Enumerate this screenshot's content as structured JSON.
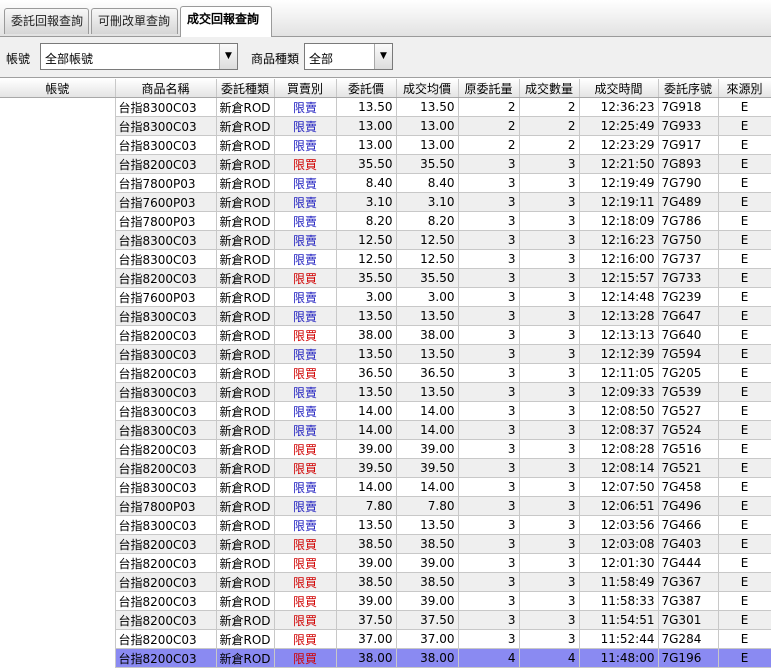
{
  "tabs": [
    {
      "label": "委託回報查詢"
    },
    {
      "label": "可刪改單查詢"
    },
    {
      "label": "成交回報查詢"
    }
  ],
  "filters": {
    "account_label": "帳號",
    "account_value": "全部帳號",
    "product_type_label": "商品種類",
    "product_type_value": "全部"
  },
  "columns": [
    "帳號",
    "商品名稱",
    "委託種類",
    "買賣別",
    "委託價",
    "成交均價",
    "原委託量",
    "成交數量",
    "成交時間",
    "委託序號",
    "來源別"
  ],
  "colors": {
    "buy": "#d00000",
    "sell": "#2020c0",
    "selected_row": "#8a8af2"
  },
  "rows": [
    {
      "product": "台指8300C03",
      "order_type": "新倉ROD",
      "side": "限賣",
      "side_code": "sell",
      "price": "13.50",
      "avg_price": "13.50",
      "order_qty": "2",
      "fill_qty": "2",
      "time": "12:36:23",
      "serial": "7G918",
      "source": "E"
    },
    {
      "product": "台指8300C03",
      "order_type": "新倉ROD",
      "side": "限賣",
      "side_code": "sell",
      "price": "13.00",
      "avg_price": "13.00",
      "order_qty": "2",
      "fill_qty": "2",
      "time": "12:25:49",
      "serial": "7G933",
      "source": "E"
    },
    {
      "product": "台指8300C03",
      "order_type": "新倉ROD",
      "side": "限賣",
      "side_code": "sell",
      "price": "13.00",
      "avg_price": "13.00",
      "order_qty": "2",
      "fill_qty": "2",
      "time": "12:23:29",
      "serial": "7G917",
      "source": "E"
    },
    {
      "product": "台指8200C03",
      "order_type": "新倉ROD",
      "side": "限買",
      "side_code": "buy",
      "price": "35.50",
      "avg_price": "35.50",
      "order_qty": "3",
      "fill_qty": "3",
      "time": "12:21:50",
      "serial": "7G893",
      "source": "E"
    },
    {
      "product": "台指7800P03",
      "order_type": "新倉ROD",
      "side": "限賣",
      "side_code": "sell",
      "price": "8.40",
      "avg_price": "8.40",
      "order_qty": "3",
      "fill_qty": "3",
      "time": "12:19:49",
      "serial": "7G790",
      "source": "E"
    },
    {
      "product": "台指7600P03",
      "order_type": "新倉ROD",
      "side": "限賣",
      "side_code": "sell",
      "price": "3.10",
      "avg_price": "3.10",
      "order_qty": "3",
      "fill_qty": "3",
      "time": "12:19:11",
      "serial": "7G489",
      "source": "E"
    },
    {
      "product": "台指7800P03",
      "order_type": "新倉ROD",
      "side": "限賣",
      "side_code": "sell",
      "price": "8.20",
      "avg_price": "8.20",
      "order_qty": "3",
      "fill_qty": "3",
      "time": "12:18:09",
      "serial": "7G786",
      "source": "E"
    },
    {
      "product": "台指8300C03",
      "order_type": "新倉ROD",
      "side": "限賣",
      "side_code": "sell",
      "price": "12.50",
      "avg_price": "12.50",
      "order_qty": "3",
      "fill_qty": "3",
      "time": "12:16:23",
      "serial": "7G750",
      "source": "E"
    },
    {
      "product": "台指8300C03",
      "order_type": "新倉ROD",
      "side": "限賣",
      "side_code": "sell",
      "price": "12.50",
      "avg_price": "12.50",
      "order_qty": "3",
      "fill_qty": "3",
      "time": "12:16:00",
      "serial": "7G737",
      "source": "E"
    },
    {
      "product": "台指8200C03",
      "order_type": "新倉ROD",
      "side": "限買",
      "side_code": "buy",
      "price": "35.50",
      "avg_price": "35.50",
      "order_qty": "3",
      "fill_qty": "3",
      "time": "12:15:57",
      "serial": "7G733",
      "source": "E"
    },
    {
      "product": "台指7600P03",
      "order_type": "新倉ROD",
      "side": "限賣",
      "side_code": "sell",
      "price": "3.00",
      "avg_price": "3.00",
      "order_qty": "3",
      "fill_qty": "3",
      "time": "12:14:48",
      "serial": "7G239",
      "source": "E"
    },
    {
      "product": "台指8300C03",
      "order_type": "新倉ROD",
      "side": "限賣",
      "side_code": "sell",
      "price": "13.50",
      "avg_price": "13.50",
      "order_qty": "3",
      "fill_qty": "3",
      "time": "12:13:28",
      "serial": "7G647",
      "source": "E"
    },
    {
      "product": "台指8200C03",
      "order_type": "新倉ROD",
      "side": "限買",
      "side_code": "buy",
      "price": "38.00",
      "avg_price": "38.00",
      "order_qty": "3",
      "fill_qty": "3",
      "time": "12:13:13",
      "serial": "7G640",
      "source": "E"
    },
    {
      "product": "台指8300C03",
      "order_type": "新倉ROD",
      "side": "限賣",
      "side_code": "sell",
      "price": "13.50",
      "avg_price": "13.50",
      "order_qty": "3",
      "fill_qty": "3",
      "time": "12:12:39",
      "serial": "7G594",
      "source": "E"
    },
    {
      "product": "台指8200C03",
      "order_type": "新倉ROD",
      "side": "限買",
      "side_code": "buy",
      "price": "36.50",
      "avg_price": "36.50",
      "order_qty": "3",
      "fill_qty": "3",
      "time": "12:11:05",
      "serial": "7G205",
      "source": "E"
    },
    {
      "product": "台指8300C03",
      "order_type": "新倉ROD",
      "side": "限賣",
      "side_code": "sell",
      "price": "13.50",
      "avg_price": "13.50",
      "order_qty": "3",
      "fill_qty": "3",
      "time": "12:09:33",
      "serial": "7G539",
      "source": "E"
    },
    {
      "product": "台指8300C03",
      "order_type": "新倉ROD",
      "side": "限賣",
      "side_code": "sell",
      "price": "14.00",
      "avg_price": "14.00",
      "order_qty": "3",
      "fill_qty": "3",
      "time": "12:08:50",
      "serial": "7G527",
      "source": "E"
    },
    {
      "product": "台指8300C03",
      "order_type": "新倉ROD",
      "side": "限賣",
      "side_code": "sell",
      "price": "14.00",
      "avg_price": "14.00",
      "order_qty": "3",
      "fill_qty": "3",
      "time": "12:08:37",
      "serial": "7G524",
      "source": "E"
    },
    {
      "product": "台指8200C03",
      "order_type": "新倉ROD",
      "side": "限買",
      "side_code": "buy",
      "price": "39.00",
      "avg_price": "39.00",
      "order_qty": "3",
      "fill_qty": "3",
      "time": "12:08:28",
      "serial": "7G516",
      "source": "E"
    },
    {
      "product": "台指8200C03",
      "order_type": "新倉ROD",
      "side": "限買",
      "side_code": "buy",
      "price": "39.50",
      "avg_price": "39.50",
      "order_qty": "3",
      "fill_qty": "3",
      "time": "12:08:14",
      "serial": "7G521",
      "source": "E"
    },
    {
      "product": "台指8300C03",
      "order_type": "新倉ROD",
      "side": "限賣",
      "side_code": "sell",
      "price": "14.00",
      "avg_price": "14.00",
      "order_qty": "3",
      "fill_qty": "3",
      "time": "12:07:50",
      "serial": "7G458",
      "source": "E"
    },
    {
      "product": "台指7800P03",
      "order_type": "新倉ROD",
      "side": "限賣",
      "side_code": "sell",
      "price": "7.80",
      "avg_price": "7.80",
      "order_qty": "3",
      "fill_qty": "3",
      "time": "12:06:51",
      "serial": "7G496",
      "source": "E"
    },
    {
      "product": "台指8300C03",
      "order_type": "新倉ROD",
      "side": "限賣",
      "side_code": "sell",
      "price": "13.50",
      "avg_price": "13.50",
      "order_qty": "3",
      "fill_qty": "3",
      "time": "12:03:56",
      "serial": "7G466",
      "source": "E"
    },
    {
      "product": "台指8200C03",
      "order_type": "新倉ROD",
      "side": "限買",
      "side_code": "buy",
      "price": "38.50",
      "avg_price": "38.50",
      "order_qty": "3",
      "fill_qty": "3",
      "time": "12:03:08",
      "serial": "7G403",
      "source": "E"
    },
    {
      "product": "台指8200C03",
      "order_type": "新倉ROD",
      "side": "限買",
      "side_code": "buy",
      "price": "39.00",
      "avg_price": "39.00",
      "order_qty": "3",
      "fill_qty": "3",
      "time": "12:01:30",
      "serial": "7G444",
      "source": "E"
    },
    {
      "product": "台指8200C03",
      "order_type": "新倉ROD",
      "side": "限買",
      "side_code": "buy",
      "price": "38.50",
      "avg_price": "38.50",
      "order_qty": "3",
      "fill_qty": "3",
      "time": "11:58:49",
      "serial": "7G367",
      "source": "E"
    },
    {
      "product": "台指8200C03",
      "order_type": "新倉ROD",
      "side": "限買",
      "side_code": "buy",
      "price": "39.00",
      "avg_price": "39.00",
      "order_qty": "3",
      "fill_qty": "3",
      "time": "11:58:33",
      "serial": "7G387",
      "source": "E"
    },
    {
      "product": "台指8200C03",
      "order_type": "新倉ROD",
      "side": "限買",
      "side_code": "buy",
      "price": "37.50",
      "avg_price": "37.50",
      "order_qty": "3",
      "fill_qty": "3",
      "time": "11:54:51",
      "serial": "7G301",
      "source": "E"
    },
    {
      "product": "台指8200C03",
      "order_type": "新倉ROD",
      "side": "限買",
      "side_code": "buy",
      "price": "37.00",
      "avg_price": "37.00",
      "order_qty": "3",
      "fill_qty": "3",
      "time": "11:52:44",
      "serial": "7G284",
      "source": "E"
    },
    {
      "product": "台指8200C03",
      "order_type": "新倉ROD",
      "side": "限買",
      "side_code": "buy",
      "price": "38.00",
      "avg_price": "38.00",
      "order_qty": "4",
      "fill_qty": "4",
      "time": "11:48:00",
      "serial": "7G196",
      "source": "E",
      "selected": true
    }
  ]
}
